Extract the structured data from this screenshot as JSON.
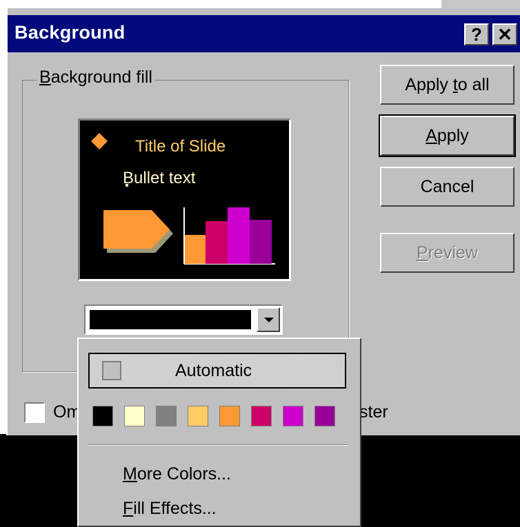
{
  "window": {
    "title": "Background"
  },
  "titlebar_buttons": {
    "help": "?",
    "close": "✕"
  },
  "group": {
    "label": "Background fill"
  },
  "preview": {
    "slide_title": "Title of Slide",
    "bullet_text": "Bullet text",
    "colors": {
      "background": "#000000",
      "title": "#ffcc66",
      "diamond": "#ff9933",
      "arrow": "#ff9933",
      "bars": [
        "#ff9933",
        "#cc0066",
        "#cc00cc",
        "#990099"
      ]
    }
  },
  "fill_dropdown": {
    "selected_color": "#000000"
  },
  "buttons": {
    "apply_to_all": "Apply to all",
    "apply": "Apply",
    "cancel": "Cancel",
    "preview": "Preview"
  },
  "omit_checkbox": {
    "label_start": "Om",
    "label_end": "ster",
    "checked": false
  },
  "color_popup": {
    "automatic_label": "Automatic",
    "swatches": [
      "#000000",
      "#ffffcc",
      "#808080",
      "#ffcc66",
      "#ff9933",
      "#cc0066",
      "#cc00cc",
      "#990099"
    ],
    "more_colors": "More Colors...",
    "fill_effects": "Fill Effects..."
  }
}
